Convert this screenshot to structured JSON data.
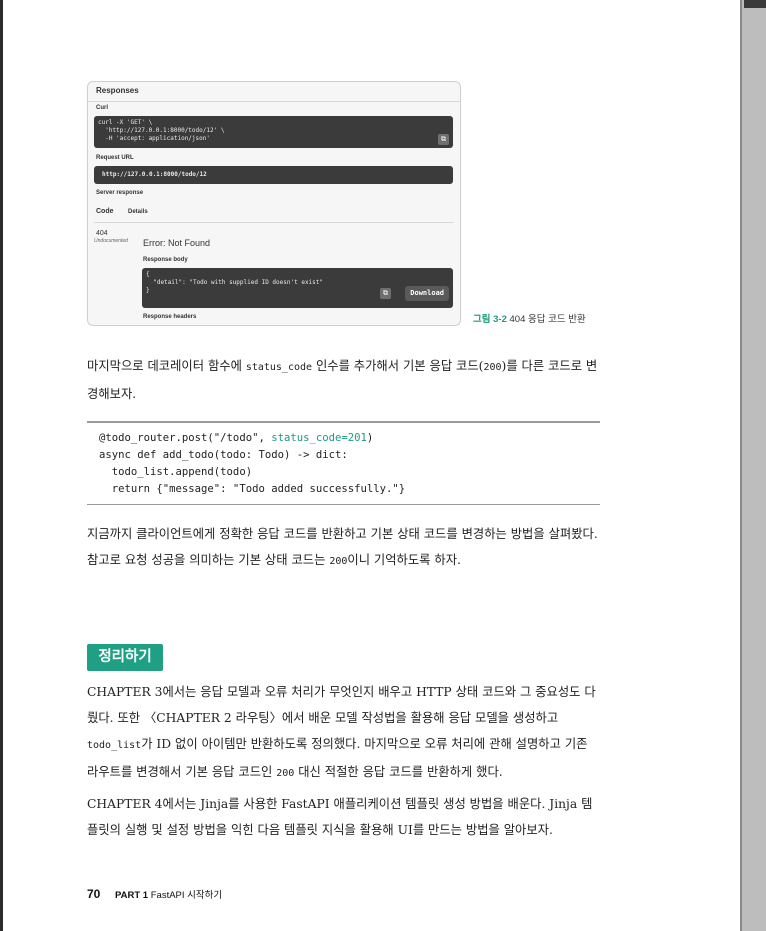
{
  "figure": {
    "responses_title": "Responses",
    "curl_label": "Curl",
    "curl_code": "curl -X 'GET' \\\n  'http://127.0.0.1:8000/todo/12' \\\n  -H 'accept: application/json'",
    "request_url_label": "Request URL",
    "request_url": "http://127.0.0.1:8000/todo/12",
    "server_response_label": "Server response",
    "code_header": "Code",
    "details_header": "Details",
    "code_value": "404",
    "undocumented": "Undocumented",
    "error_text": "Error: Not Found",
    "response_body_label": "Response body",
    "response_body": "{\n  \"detail\": \"Todo with supplied ID doesn't exist\"\n}",
    "download_label": "Download",
    "response_headers_label": "Response headers"
  },
  "caption": {
    "number": "그림 3-2",
    "text": "404 응답 코드 반환"
  },
  "para1": {
    "a": "마지막으로 데코레이터 함수에 ",
    "code1": "status_code",
    "b": " 인수를 추가해서 기본 응답 코드(",
    "code2": "200",
    "c": ")를 다른 코드로 변경해보자."
  },
  "code_block": {
    "l1a": "@todo_router.post(\"/todo\", ",
    "l1b": "status_code=201",
    "l1c": ")",
    "l2": "async def add_todo(todo: Todo) -> dict:",
    "l3": "  todo_list.append(todo)",
    "l4": "  return {\"message\": \"Todo added successfully.\"}"
  },
  "para2": {
    "a": "지금까지 클라이언트에게 정확한 응답 코드를 반환하고 기본 상태 코드를 변경하는 방법을 살펴봤다. 참고로 요청 성공을 의미하는 기본 상태 코드는 ",
    "code": "200",
    "b": "이니 기억하도록 하자."
  },
  "section_title": "정리하기",
  "para3": {
    "a": "CHAPTER 3에서는 응답 모델과 오류 처리가 무엇인지 배우고 HTTP 상태 코드와 그 중요성도 다뤘다. 또한 〈CHAPTER 2 라우팅〉에서 배운 모델 작성법을 활용해 응답 모델을 생성하고 ",
    "code1": "todo_list",
    "b": "가 ID 없이 아이템만 반환하도록 정의했다. 마지막으로 오류 처리에 관해 설명하고 기존 라우트를 변경해서 기본 응답 코드인 ",
    "code2": "200",
    "c": " 대신 적절한 응답 코드를 반환하게 했다."
  },
  "para4": "CHAPTER 4에서는 Jinja를 사용한 FastAPI 애플리케이션 템플릿 생성 방법을 배운다. Jinja 템플릿의 실행 및 설정 방법을 익힌 다음 템플릿 지식을 활용해 UI를 만드는 방법을 알아보자.",
  "footer": {
    "page": "70",
    "part": "PART 1",
    "part_title": "FastAPI 시작하기"
  },
  "colors": {
    "accent": "#1fa084"
  }
}
